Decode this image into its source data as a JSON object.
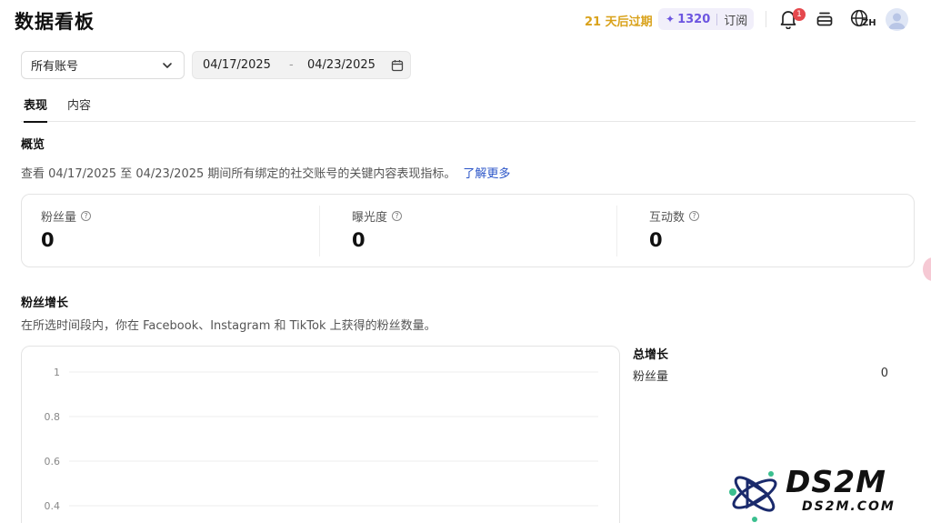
{
  "header": {
    "title": "数据看板",
    "expire_text": "21 天后过期",
    "credits": "1320",
    "subscribe_label": "订阅",
    "notification_count": "1",
    "language": "ZH"
  },
  "filters": {
    "account_select": "所有账号",
    "date_start": "04/17/2025",
    "date_separator": "-",
    "date_end": "04/23/2025"
  },
  "tabs": [
    {
      "label": "表现",
      "active": true
    },
    {
      "label": "内容",
      "active": false
    }
  ],
  "overview": {
    "title": "概览",
    "description": "查看 04/17/2025 至 04/23/2025 期间所有绑定的社交账号的关键内容表现指标。",
    "learn_more": "了解更多",
    "metrics": [
      {
        "label": "粉丝量",
        "value": "0"
      },
      {
        "label": "曝光度",
        "value": "0"
      },
      {
        "label": "互动数",
        "value": "0"
      }
    ]
  },
  "follower_growth": {
    "title": "粉丝增长",
    "description": "在所选时间段内，你在 Facebook、Instagram 和 TikTok 上获得的粉丝数量。",
    "total_title": "总增长",
    "total_rows": [
      {
        "label": "粉丝量",
        "value": "0"
      }
    ]
  },
  "chart_data": {
    "type": "line",
    "y_ticks": [
      "1",
      "0.8",
      "0.6",
      "0.4"
    ],
    "ylim": [
      0,
      1
    ],
    "grid": true,
    "series": []
  },
  "watermark": {
    "big": "DS2M",
    "small": "DS2M.COM"
  }
}
